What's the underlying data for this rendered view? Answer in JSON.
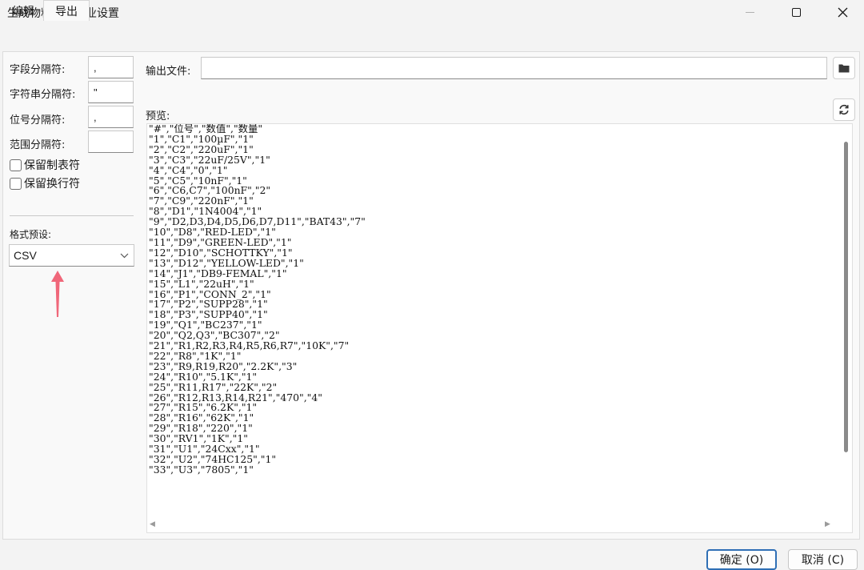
{
  "window": {
    "title": "生成物料清单作业设置"
  },
  "tabs": [
    {
      "label": "编辑"
    },
    {
      "label": "导出"
    }
  ],
  "separators": {
    "field_label": "字段分隔符:",
    "field_value": ",",
    "string_label": "字符串分隔符:",
    "string_value": "\"",
    "ref_label": "位号分隔符:",
    "ref_value": ",",
    "range_label": "范围分隔符:",
    "range_value": ""
  },
  "options": {
    "keep_tabs": "保留制表符",
    "keep_newlines": "保留换行符"
  },
  "preset": {
    "label": "格式预设:",
    "value": "CSV"
  },
  "output": {
    "label": "输出文件:",
    "value": ""
  },
  "preview": {
    "label": "预览:",
    "lines": [
      "\"#\",\"位号\",\"数值\",\"数量\"",
      "\"1\",\"C1\",\"100µF\",\"1\"",
      "\"2\",\"C2\",\"220uF\",\"1\"",
      "\"3\",\"C3\",\"22uF/25V\",\"1\"",
      "\"4\",\"C4\",\"0\",\"1\"",
      "\"5\",\"C5\",\"10nF\",\"1\"",
      "\"6\",\"C6,C7\",\"100nF\",\"2\"",
      "\"7\",\"C9\",\"220nF\",\"1\"",
      "\"8\",\"D1\",\"1N4004\",\"1\"",
      "\"9\",\"D2,D3,D4,D5,D6,D7,D11\",\"BAT43\",\"7\"",
      "\"10\",\"D8\",\"RED-LED\",\"1\"",
      "\"11\",\"D9\",\"GREEN-LED\",\"1\"",
      "\"12\",\"D10\",\"SCHOTTKY\",\"1\"",
      "\"13\",\"D12\",\"YELLOW-LED\",\"1\"",
      "\"14\",\"J1\",\"DB9-FEMAL\",\"1\"",
      "\"15\",\"L1\",\"22uH\",\"1\"",
      "\"16\",\"P1\",\"CONN_2\",\"1\"",
      "\"17\",\"P2\",\"SUPP28\",\"1\"",
      "\"18\",\"P3\",\"SUPP40\",\"1\"",
      "\"19\",\"Q1\",\"BC237\",\"1\"",
      "\"20\",\"Q2,Q3\",\"BC307\",\"2\"",
      "\"21\",\"R1,R2,R3,R4,R5,R6,R7\",\"10K\",\"7\"",
      "\"22\",\"R8\",\"1K\",\"1\"",
      "\"23\",\"R9,R19,R20\",\"2.2K\",\"3\"",
      "\"24\",\"R10\",\"5.1K\",\"1\"",
      "\"25\",\"R11,R17\",\"22K\",\"2\"",
      "\"26\",\"R12,R13,R14,R21\",\"470\",\"4\"",
      "\"27\",\"R15\",\"6.2K\",\"1\"",
      "\"28\",\"R16\",\"62K\",\"1\"",
      "\"29\",\"R18\",\"220\",\"1\"",
      "\"30\",\"RV1\",\"1K\",\"1\"",
      "\"31\",\"U1\",\"24Cxx\",\"1\"",
      "\"32\",\"U2\",\"74HC125\",\"1\"",
      "\"33\",\"U3\",\"7805\",\"1\""
    ]
  },
  "buttons": {
    "ok": "确定 (O)",
    "cancel": "取消 (C)"
  },
  "icons": {
    "folder": "folder-icon",
    "refresh": "refresh-icon",
    "annotation_arrow_color": "#f0677a"
  }
}
